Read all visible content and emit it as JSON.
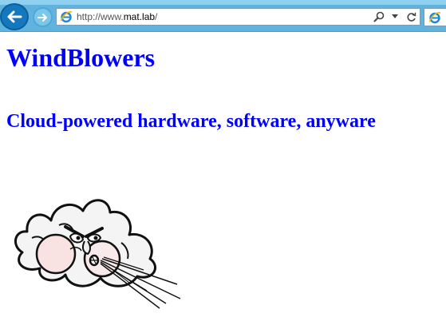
{
  "browser": {
    "url_prefix": "http://www.",
    "url_host": "mat.lab",
    "url_suffix": "/",
    "icons": {
      "back": "back-arrow-icon",
      "forward": "forward-arrow-icon",
      "page": "internet-explorer-icon",
      "search": "search-icon",
      "dropdown": "chevron-down-icon",
      "refresh": "refresh-icon"
    },
    "colors": {
      "toolbar": "#5fb3dd",
      "back_button": "#1378be"
    }
  },
  "page": {
    "title": "WindBlowers",
    "tagline": "Cloud-powered hardware, software, anyware",
    "title_color": "#0000ff",
    "illustration": "blowing-cloud-cartoon"
  }
}
